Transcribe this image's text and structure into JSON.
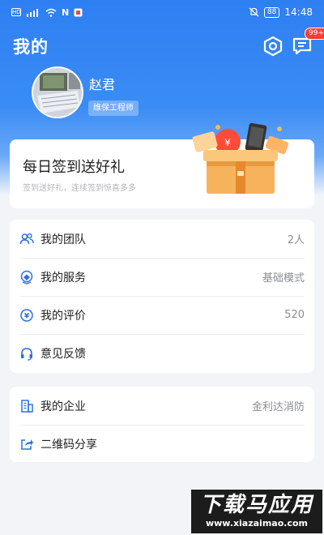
{
  "status_bar": {
    "time": "14:48",
    "battery": "88",
    "nfc": "N"
  },
  "header": {
    "title": "我的",
    "message_badge": "99+"
  },
  "profile": {
    "name": "赵君",
    "role": "维保工程师"
  },
  "checkin": {
    "title": "每日签到送好礼",
    "subtitle": "签到送好礼，连续签到惊喜多多"
  },
  "menu_group_1": [
    {
      "label": "我的团队",
      "value": "2人",
      "icon": "team-icon"
    },
    {
      "label": "我的服务",
      "value": "基础模式",
      "icon": "service-icon"
    },
    {
      "label": "我的评价",
      "value": "520",
      "icon": "rating-icon"
    },
    {
      "label": "意见反馈",
      "value": "",
      "icon": "headset-icon"
    }
  ],
  "menu_group_2": [
    {
      "label": "我的企业",
      "value": "金利达消防",
      "icon": "building-icon"
    },
    {
      "label": "二维码分享",
      "value": "",
      "icon": "share-icon"
    }
  ],
  "watermark": {
    "main": "下载马应用",
    "url": "www.xiazaimao.com"
  },
  "colors": {
    "brand_blue": "#2e7ff2",
    "badge_red": "#ff3b30",
    "icon_blue": "#2f6fe0"
  }
}
